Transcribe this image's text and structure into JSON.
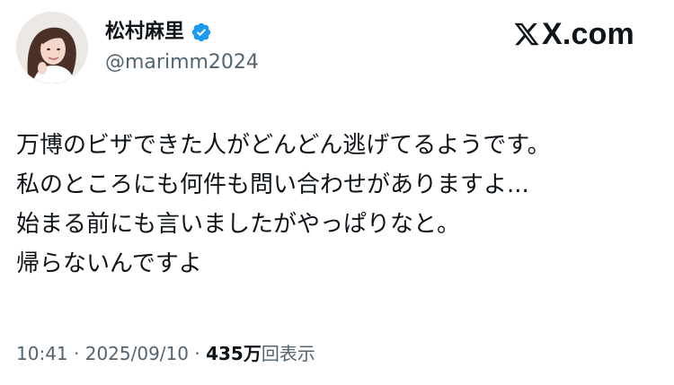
{
  "author": {
    "display_name": "松村麻里",
    "handle": "@marimm2024",
    "verified_icon": "verified-badge-icon",
    "badge_color": "#1d9bf0"
  },
  "brand": {
    "icon": "x-logo-icon",
    "text": "X.com"
  },
  "tweet": {
    "lines": [
      "万博のビザできた人がどんどん逃げてるようです。",
      "私のところにも何件も問い合わせがありますよ...",
      "始まる前にも言いましたがやっぱりなと。",
      "帰らないんですよ"
    ]
  },
  "meta": {
    "time": "10:41",
    "separator": " · ",
    "date": "2025/09/10",
    "views_count": "435万",
    "views_label": "回表示"
  },
  "colors": {
    "text": "#0f1419",
    "secondary": "#536471",
    "accent": "#1d9bf0"
  }
}
